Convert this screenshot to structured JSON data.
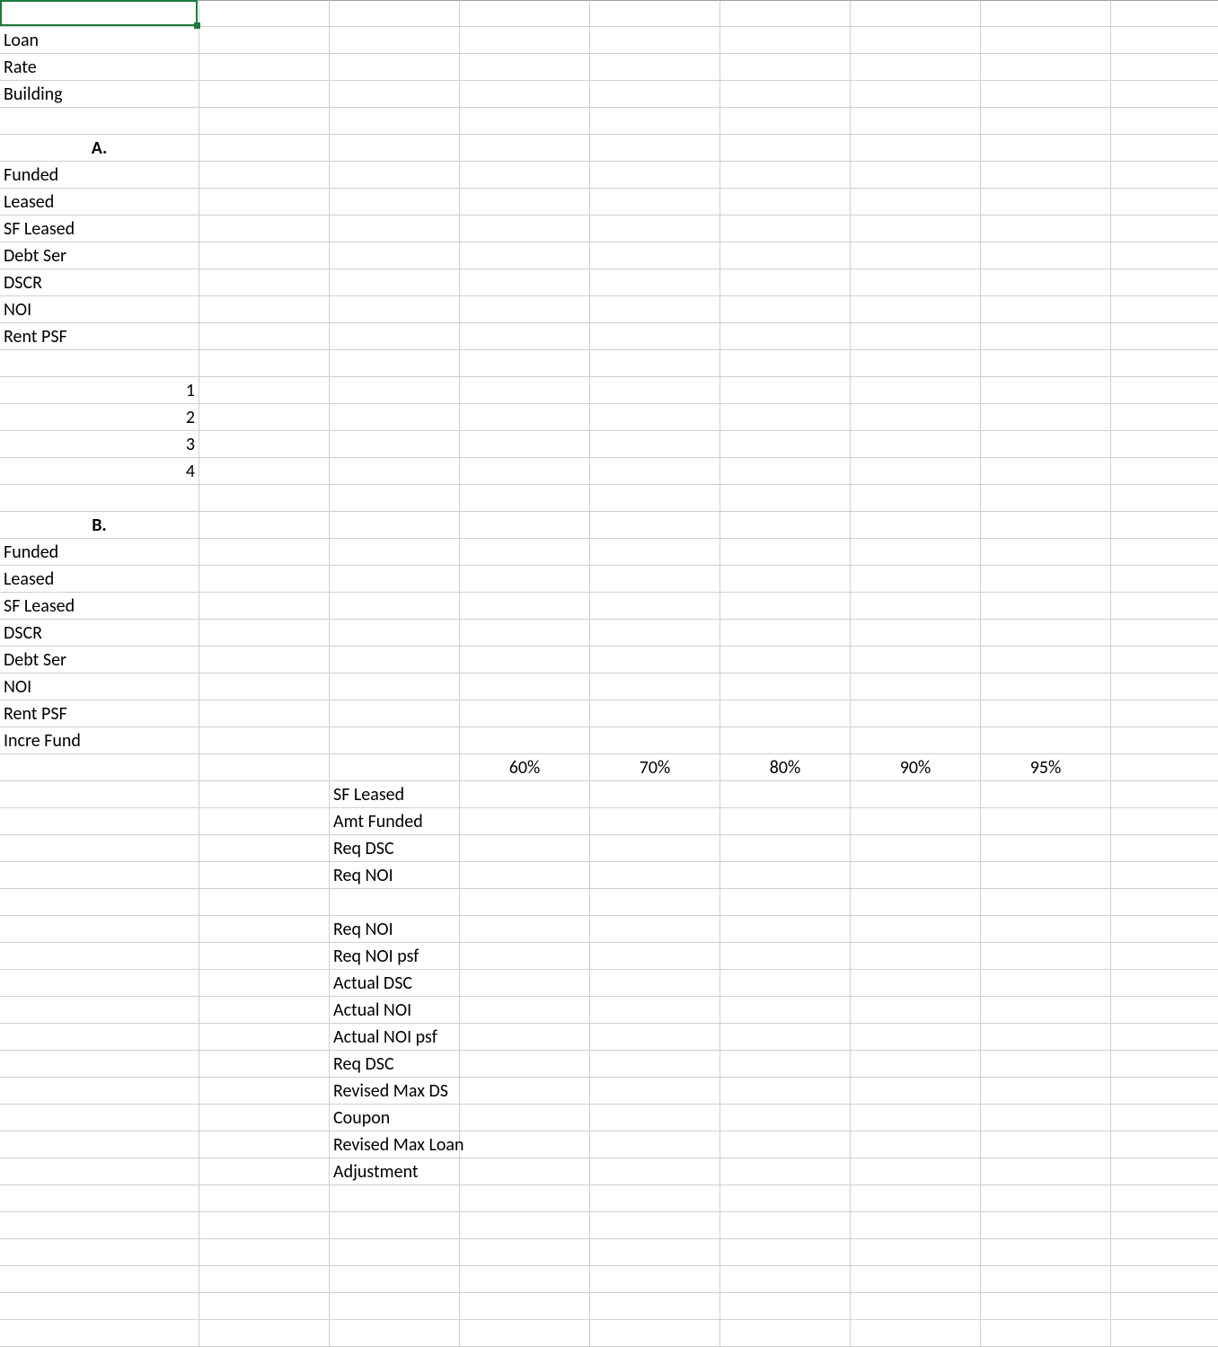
{
  "labels": {
    "loan": "Loan",
    "rate": "Rate",
    "building": "Building",
    "sectionA": "A.",
    "funded": "Funded",
    "leased": "Leased",
    "sf_leased": "SF Leased",
    "debt_ser": "Debt Ser",
    "dscr": "DSCR",
    "noi": "NOI",
    "rent_psf": "Rent PSF",
    "n1": "1",
    "n2": "2",
    "n3": "3",
    "n4": "4",
    "sectionB": "B.",
    "incre_fund": "Incre Fund",
    "pct60": "60%",
    "pct70": "70%",
    "pct80": "80%",
    "pct90": "90%",
    "pct95": "95%",
    "amt_funded": "Amt Funded",
    "req_dsc": "Req DSC",
    "req_noi": "Req NOI",
    "req_noi_psf": "Req NOI psf",
    "actual_dsc": "Actual DSC",
    "actual_noi": "Actual NOI",
    "actual_noi_psf": "Actual NOI psf",
    "revised_max_ds": "Revised Max DS",
    "coupon": "Coupon",
    "revised_max_loan": "Revised Max Loan",
    "adjustment": "Adjustment"
  },
  "rows": [
    {
      "a": "",
      "a_class": "",
      "c": "",
      "d": "",
      "e": "",
      "f": "",
      "g": "",
      "h": ""
    },
    {
      "a": "loan",
      "a_class": "",
      "c": "",
      "d": "",
      "e": "",
      "f": "",
      "g": "",
      "h": ""
    },
    {
      "a": "rate",
      "a_class": "",
      "c": "",
      "d": "",
      "e": "",
      "f": "",
      "g": "",
      "h": ""
    },
    {
      "a": "building",
      "a_class": "",
      "c": "",
      "d": "",
      "e": "",
      "f": "",
      "g": "",
      "h": ""
    },
    {
      "a": "",
      "a_class": "",
      "c": "",
      "d": "",
      "e": "",
      "f": "",
      "g": "",
      "h": ""
    },
    {
      "a": "sectionA",
      "a_class": "center bold",
      "c": "",
      "d": "",
      "e": "",
      "f": "",
      "g": "",
      "h": ""
    },
    {
      "a": "funded",
      "a_class": "",
      "c": "",
      "d": "",
      "e": "",
      "f": "",
      "g": "",
      "h": ""
    },
    {
      "a": "leased",
      "a_class": "",
      "c": "",
      "d": "",
      "e": "",
      "f": "",
      "g": "",
      "h": ""
    },
    {
      "a": "sf_leased",
      "a_class": "",
      "c": "",
      "d": "",
      "e": "",
      "f": "",
      "g": "",
      "h": ""
    },
    {
      "a": "debt_ser",
      "a_class": "",
      "c": "",
      "d": "",
      "e": "",
      "f": "",
      "g": "",
      "h": ""
    },
    {
      "a": "dscr",
      "a_class": "",
      "c": "",
      "d": "",
      "e": "",
      "f": "",
      "g": "",
      "h": ""
    },
    {
      "a": "noi",
      "a_class": "",
      "c": "",
      "d": "",
      "e": "",
      "f": "",
      "g": "",
      "h": ""
    },
    {
      "a": "rent_psf",
      "a_class": "",
      "c": "",
      "d": "",
      "e": "",
      "f": "",
      "g": "",
      "h": ""
    },
    {
      "a": "",
      "a_class": "",
      "c": "",
      "d": "",
      "e": "",
      "f": "",
      "g": "",
      "h": ""
    },
    {
      "a": "n1",
      "a_class": "right",
      "c": "",
      "d": "",
      "e": "",
      "f": "",
      "g": "",
      "h": ""
    },
    {
      "a": "n2",
      "a_class": "right",
      "c": "",
      "d": "",
      "e": "",
      "f": "",
      "g": "",
      "h": ""
    },
    {
      "a": "n3",
      "a_class": "right",
      "c": "",
      "d": "",
      "e": "",
      "f": "",
      "g": "",
      "h": ""
    },
    {
      "a": "n4",
      "a_class": "right",
      "c": "",
      "d": "",
      "e": "",
      "f": "",
      "g": "",
      "h": ""
    },
    {
      "a": "",
      "a_class": "",
      "c": "",
      "d": "",
      "e": "",
      "f": "",
      "g": "",
      "h": ""
    },
    {
      "a": "sectionB",
      "a_class": "center bold",
      "c": "",
      "d": "",
      "e": "",
      "f": "",
      "g": "",
      "h": ""
    },
    {
      "a": "funded",
      "a_class": "",
      "c": "",
      "d": "",
      "e": "",
      "f": "",
      "g": "",
      "h": ""
    },
    {
      "a": "leased",
      "a_class": "",
      "c": "",
      "d": "",
      "e": "",
      "f": "",
      "g": "",
      "h": ""
    },
    {
      "a": "sf_leased",
      "a_class": "",
      "c": "",
      "d": "",
      "e": "",
      "f": "",
      "g": "",
      "h": ""
    },
    {
      "a": "dscr",
      "a_class": "",
      "c": "",
      "d": "",
      "e": "",
      "f": "",
      "g": "",
      "h": ""
    },
    {
      "a": "debt_ser",
      "a_class": "",
      "c": "",
      "d": "",
      "e": "",
      "f": "",
      "g": "",
      "h": ""
    },
    {
      "a": "noi",
      "a_class": "",
      "c": "",
      "d": "",
      "e": "",
      "f": "",
      "g": "",
      "h": ""
    },
    {
      "a": "rent_psf",
      "a_class": "",
      "c": "",
      "d": "",
      "e": "",
      "f": "",
      "g": "",
      "h": ""
    },
    {
      "a": "incre_fund",
      "a_class": "",
      "c": "",
      "d": "",
      "e": "",
      "f": "",
      "g": "",
      "h": ""
    },
    {
      "a": "",
      "a_class": "",
      "c": "",
      "d": "pct60",
      "e": "pct70",
      "f": "pct80",
      "g": "pct90",
      "h": "pct95",
      "de_class": "center"
    },
    {
      "a": "",
      "a_class": "",
      "c": "sf_leased",
      "d": "",
      "e": "",
      "f": "",
      "g": "",
      "h": ""
    },
    {
      "a": "",
      "a_class": "",
      "c": "amt_funded",
      "d": "",
      "e": "",
      "f": "",
      "g": "",
      "h": ""
    },
    {
      "a": "",
      "a_class": "",
      "c": "req_dsc",
      "d": "",
      "e": "",
      "f": "",
      "g": "",
      "h": ""
    },
    {
      "a": "",
      "a_class": "",
      "c": "req_noi",
      "d": "",
      "e": "",
      "f": "",
      "g": "",
      "h": ""
    },
    {
      "a": "",
      "a_class": "",
      "c": "",
      "d": "",
      "e": "",
      "f": "",
      "g": "",
      "h": ""
    },
    {
      "a": "",
      "a_class": "",
      "c": "req_noi",
      "d": "",
      "e": "",
      "f": "",
      "g": "",
      "h": ""
    },
    {
      "a": "",
      "a_class": "",
      "c": "req_noi_psf",
      "d": "",
      "e": "",
      "f": "",
      "g": "",
      "h": ""
    },
    {
      "a": "",
      "a_class": "",
      "c": "actual_dsc",
      "d": "",
      "e": "",
      "f": "",
      "g": "",
      "h": ""
    },
    {
      "a": "",
      "a_class": "",
      "c": "actual_noi",
      "d": "",
      "e": "",
      "f": "",
      "g": "",
      "h": ""
    },
    {
      "a": "",
      "a_class": "",
      "c": "actual_noi_psf",
      "d": "",
      "e": "",
      "f": "",
      "g": "",
      "h": ""
    },
    {
      "a": "",
      "a_class": "",
      "c": "req_dsc",
      "d": "",
      "e": "",
      "f": "",
      "g": "",
      "h": ""
    },
    {
      "a": "",
      "a_class": "",
      "c": "revised_max_ds",
      "d": "",
      "e": "",
      "f": "",
      "g": "",
      "h": ""
    },
    {
      "a": "",
      "a_class": "",
      "c": "coupon",
      "d": "",
      "e": "",
      "f": "",
      "g": "",
      "h": ""
    },
    {
      "a": "",
      "a_class": "",
      "c": "revised_max_loan",
      "d": "",
      "e": "",
      "f": "",
      "g": "",
      "h": ""
    },
    {
      "a": "",
      "a_class": "",
      "c": "adjustment",
      "d": "",
      "e": "",
      "f": "",
      "g": "",
      "h": ""
    },
    {
      "a": "",
      "a_class": "",
      "c": "",
      "d": "",
      "e": "",
      "f": "",
      "g": "",
      "h": ""
    },
    {
      "a": "",
      "a_class": "",
      "c": "",
      "d": "",
      "e": "",
      "f": "",
      "g": "",
      "h": ""
    },
    {
      "a": "",
      "a_class": "",
      "c": "",
      "d": "",
      "e": "",
      "f": "",
      "g": "",
      "h": ""
    },
    {
      "a": "",
      "a_class": "",
      "c": "",
      "d": "",
      "e": "",
      "f": "",
      "g": "",
      "h": ""
    },
    {
      "a": "",
      "a_class": "",
      "c": "",
      "d": "",
      "e": "",
      "f": "",
      "g": "",
      "h": ""
    },
    {
      "a": "",
      "a_class": "",
      "c": "",
      "d": "",
      "e": "",
      "f": "",
      "g": "",
      "h": ""
    }
  ]
}
